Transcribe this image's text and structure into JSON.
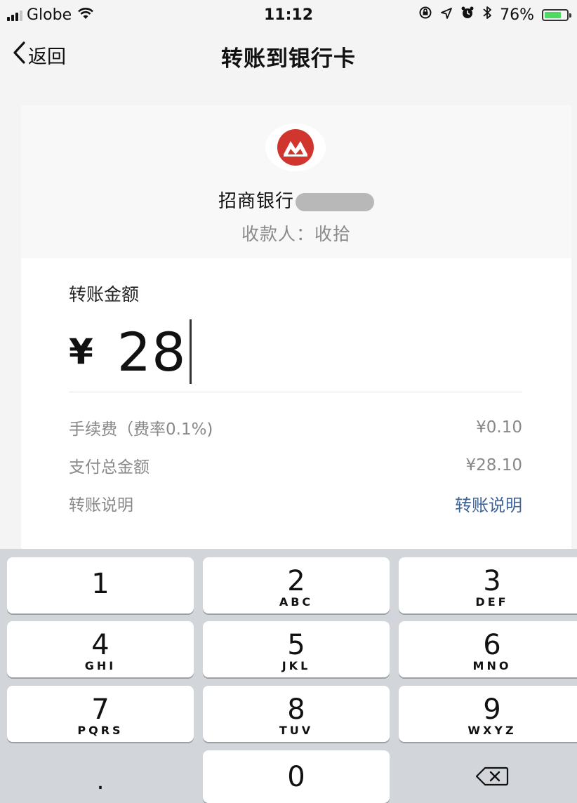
{
  "status_bar": {
    "carrier": "Globe",
    "time": "11:12",
    "battery_percent": "76%",
    "battery_level": 0.76
  },
  "nav": {
    "back_label": "返回",
    "title": "转账到银行卡"
  },
  "bank": {
    "name": "招商银行",
    "payee": "收款人：收拾",
    "logo_color": "#d0352e"
  },
  "transfer": {
    "amount_label": "转账金额",
    "currency_symbol": "¥",
    "amount": "28",
    "fee_label": "手续费（费率0.1%)",
    "fee_value": "¥0.10",
    "total_label": "支付总金额",
    "total_value": "¥28.10",
    "note_label": "转账说明",
    "note_link": "转账说明"
  },
  "keypad": {
    "keys": [
      {
        "digit": "1",
        "letters": ""
      },
      {
        "digit": "2",
        "letters": "ABC"
      },
      {
        "digit": "3",
        "letters": "DEF"
      },
      {
        "digit": "4",
        "letters": "GHI"
      },
      {
        "digit": "5",
        "letters": "JKL"
      },
      {
        "digit": "6",
        "letters": "MNO"
      },
      {
        "digit": "7",
        "letters": "PQRS"
      },
      {
        "digit": "8",
        "letters": "TUV"
      },
      {
        "digit": "9",
        "letters": "WXYZ"
      },
      {
        "digit": ".",
        "letters": ""
      },
      {
        "digit": "0",
        "letters": ""
      }
    ],
    "delete_icon": "backspace-icon"
  }
}
